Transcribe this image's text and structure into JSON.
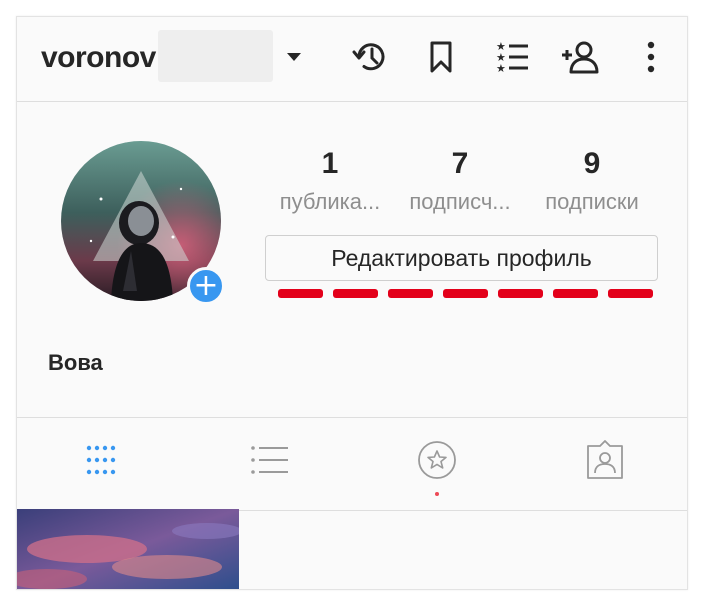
{
  "header": {
    "username": "voronov",
    "icons": [
      "chevron-down-icon",
      "history-icon",
      "bookmark-icon",
      "star-list-icon",
      "add-user-icon",
      "more-icon"
    ]
  },
  "profile": {
    "display_name": "Вова",
    "edit_button_label": "Редактировать профиль",
    "stats": [
      {
        "value": "1",
        "label": "публика..."
      },
      {
        "value": "7",
        "label": "подписч..."
      },
      {
        "value": "9",
        "label": "подписки"
      }
    ]
  },
  "tabs": [
    "grid-icon",
    "list-icon",
    "star-icon",
    "tagged-icon"
  ],
  "colors": {
    "accent": "#3897f0",
    "annotation_red": "#e3001a",
    "text": "#262626",
    "muted": "#8e8e8e",
    "border": "#dedede"
  }
}
